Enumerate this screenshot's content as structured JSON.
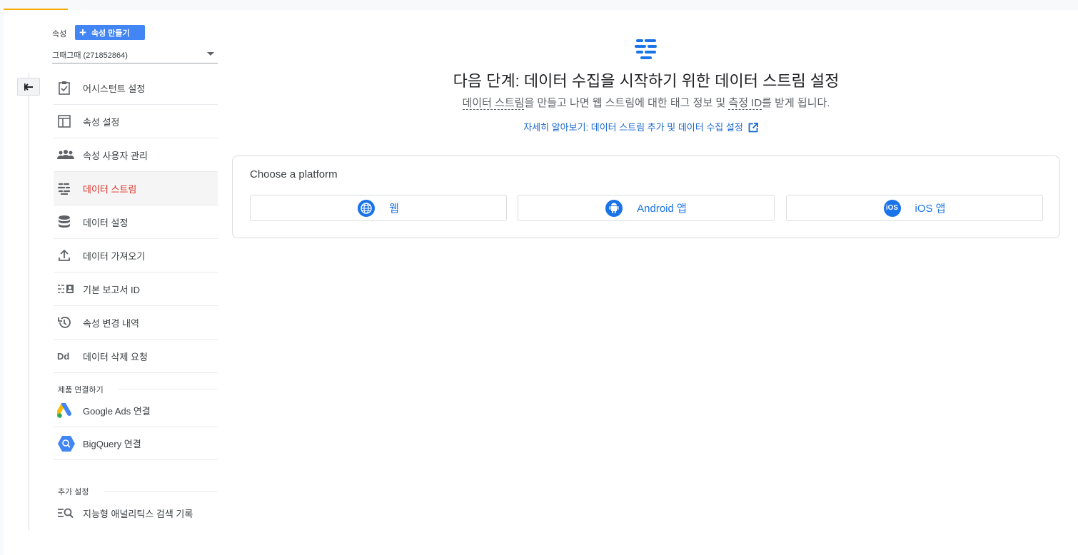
{
  "sidebar": {
    "property_label": "속성",
    "create_button": "속성 만들기",
    "property_selector": "그때그때 (271852864)",
    "items": [
      {
        "label": "어시스턴트 설정",
        "icon": "clipboard-check-icon"
      },
      {
        "label": "속성 설정",
        "icon": "layout-icon"
      },
      {
        "label": "속성 사용자 관리",
        "icon": "people-icon"
      },
      {
        "label": "데이터 스트림",
        "icon": "data-stream-icon",
        "active": true
      },
      {
        "label": "데이터 설정",
        "icon": "database-icon"
      },
      {
        "label": "데이터 가져오기",
        "icon": "upload-icon"
      },
      {
        "label": "기본 보고서 ID",
        "icon": "reporting-id-icon"
      },
      {
        "label": "속성 변경 내역",
        "icon": "history-icon"
      },
      {
        "label": "데이터 삭제 요청",
        "icon": "dd-icon",
        "icon_text": "Dd"
      }
    ],
    "product_links_header": "제품 연결하기",
    "product_links": [
      {
        "label": "Google Ads 연결",
        "icon": "google-ads-icon"
      },
      {
        "label": "BigQuery 연결",
        "icon": "bigquery-icon"
      }
    ],
    "extra_header": "추가 설정",
    "extra_items": [
      {
        "label": "지능형 애널리틱스 검색 기록",
        "icon": "search-history-icon"
      }
    ]
  },
  "main": {
    "headline": "다음 단계: 데이터 수집을 시작하기 위한 데이터 스트림 설정",
    "sub_part1": "데이터 스트림",
    "sub_part2": "을 만들고 나면 웹 스트림에 대한 태그 정보 및 ",
    "sub_part3": "측정 ID",
    "sub_part4": "를 받게 됩니다.",
    "learn_more": "자세히 알아보기: 데이터 스트림 추가 및 데이터 수집 설정",
    "card_title": "Choose a platform",
    "platforms": [
      {
        "label": "웹",
        "icon": "globe-icon"
      },
      {
        "label": "Android 앱",
        "icon": "android-icon"
      },
      {
        "label": "iOS 앱",
        "icon": "ios-icon",
        "icon_text": "iOS"
      }
    ]
  },
  "colors": {
    "accent_orange": "#f9ab00",
    "primary_blue": "#1a73e8",
    "active_red": "#d93025"
  }
}
